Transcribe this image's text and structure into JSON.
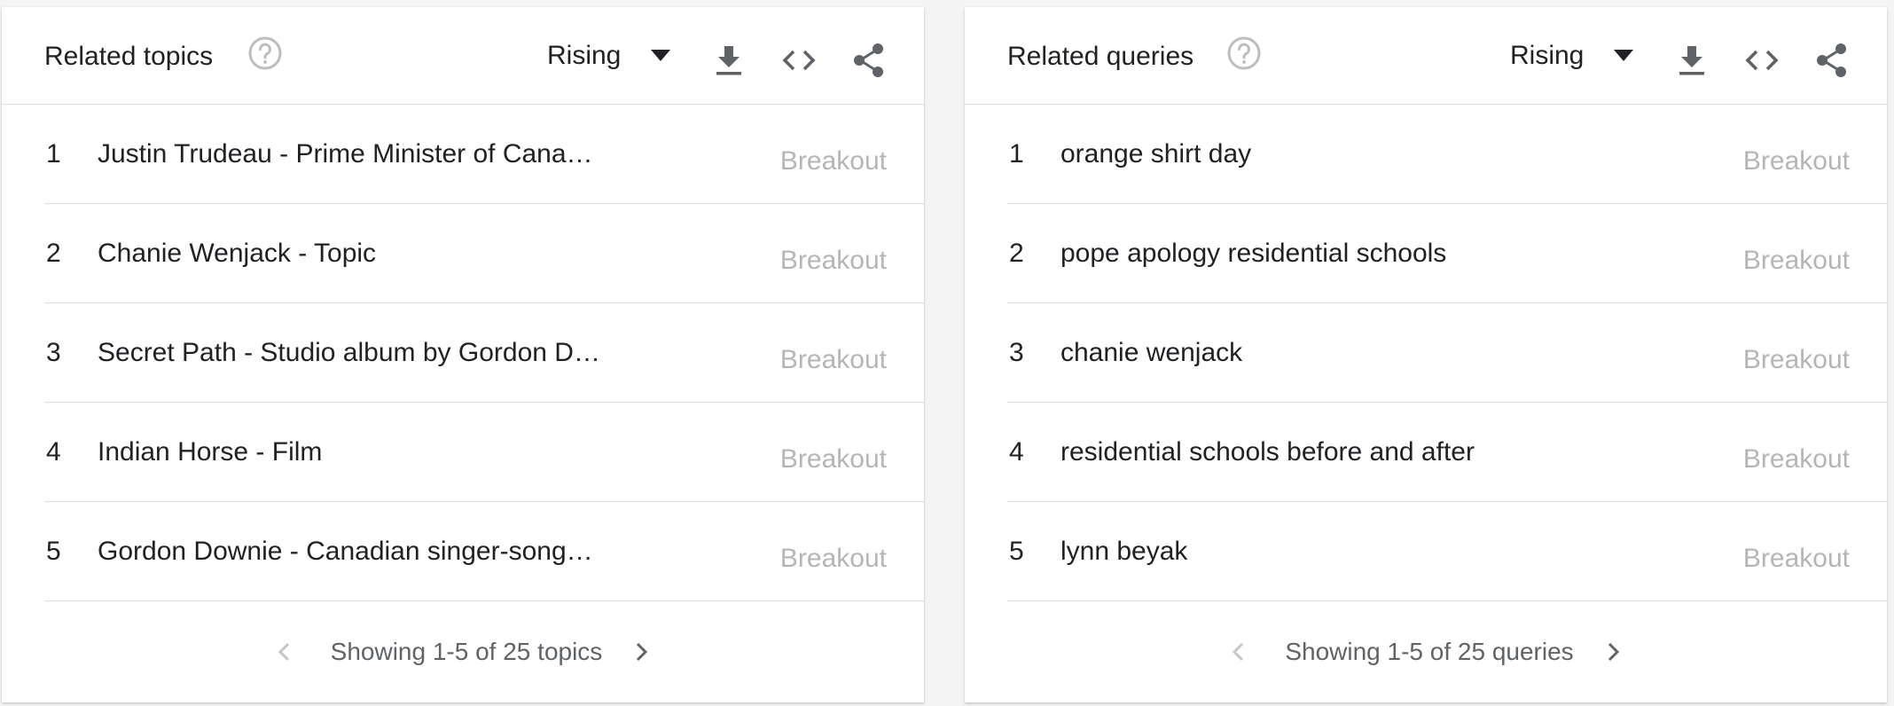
{
  "panels": [
    {
      "title": "Related topics",
      "filter": "Rising",
      "icons": {
        "help": "help-circle-icon",
        "dropdown": "caret-down-icon",
        "download": "download-icon",
        "embed": "code-embed-icon",
        "share": "share-icon",
        "prev": "chevron-left-icon",
        "next": "chevron-right-icon"
      },
      "rows": [
        {
          "rank": "1",
          "term": "Justin Trudeau - Prime Minister of Cana…",
          "value": "Breakout"
        },
        {
          "rank": "2",
          "term": "Chanie Wenjack - Topic",
          "value": "Breakout"
        },
        {
          "rank": "3",
          "term": "Secret Path - Studio album by Gordon D…",
          "value": "Breakout"
        },
        {
          "rank": "4",
          "term": "Indian Horse - Film",
          "value": "Breakout"
        },
        {
          "rank": "5",
          "term": "Gordon Downie - Canadian singer-song…",
          "value": "Breakout"
        }
      ],
      "pager": "Showing 1-5 of 25 topics"
    },
    {
      "title": "Related queries",
      "filter": "Rising",
      "icons": {
        "help": "help-circle-icon",
        "dropdown": "caret-down-icon",
        "download": "download-icon",
        "embed": "code-embed-icon",
        "share": "share-icon",
        "prev": "chevron-left-icon",
        "next": "chevron-right-icon"
      },
      "rows": [
        {
          "rank": "1",
          "term": "orange shirt day",
          "value": "Breakout"
        },
        {
          "rank": "2",
          "term": "pope apology residential schools",
          "value": "Breakout"
        },
        {
          "rank": "3",
          "term": "chanie wenjack",
          "value": "Breakout"
        },
        {
          "rank": "4",
          "term": "residential schools before and after",
          "value": "Breakout"
        },
        {
          "rank": "5",
          "term": "lynn beyak",
          "value": "Breakout"
        }
      ],
      "pager": "Showing 1-5 of 25 queries"
    }
  ],
  "colors": {
    "text": "#202124",
    "muted": "#b5b5b5",
    "icon": "#5f6368",
    "help": "#bdbdbd",
    "nav_disabled": "#c6c6c6",
    "divider": "#dcdcdc"
  }
}
